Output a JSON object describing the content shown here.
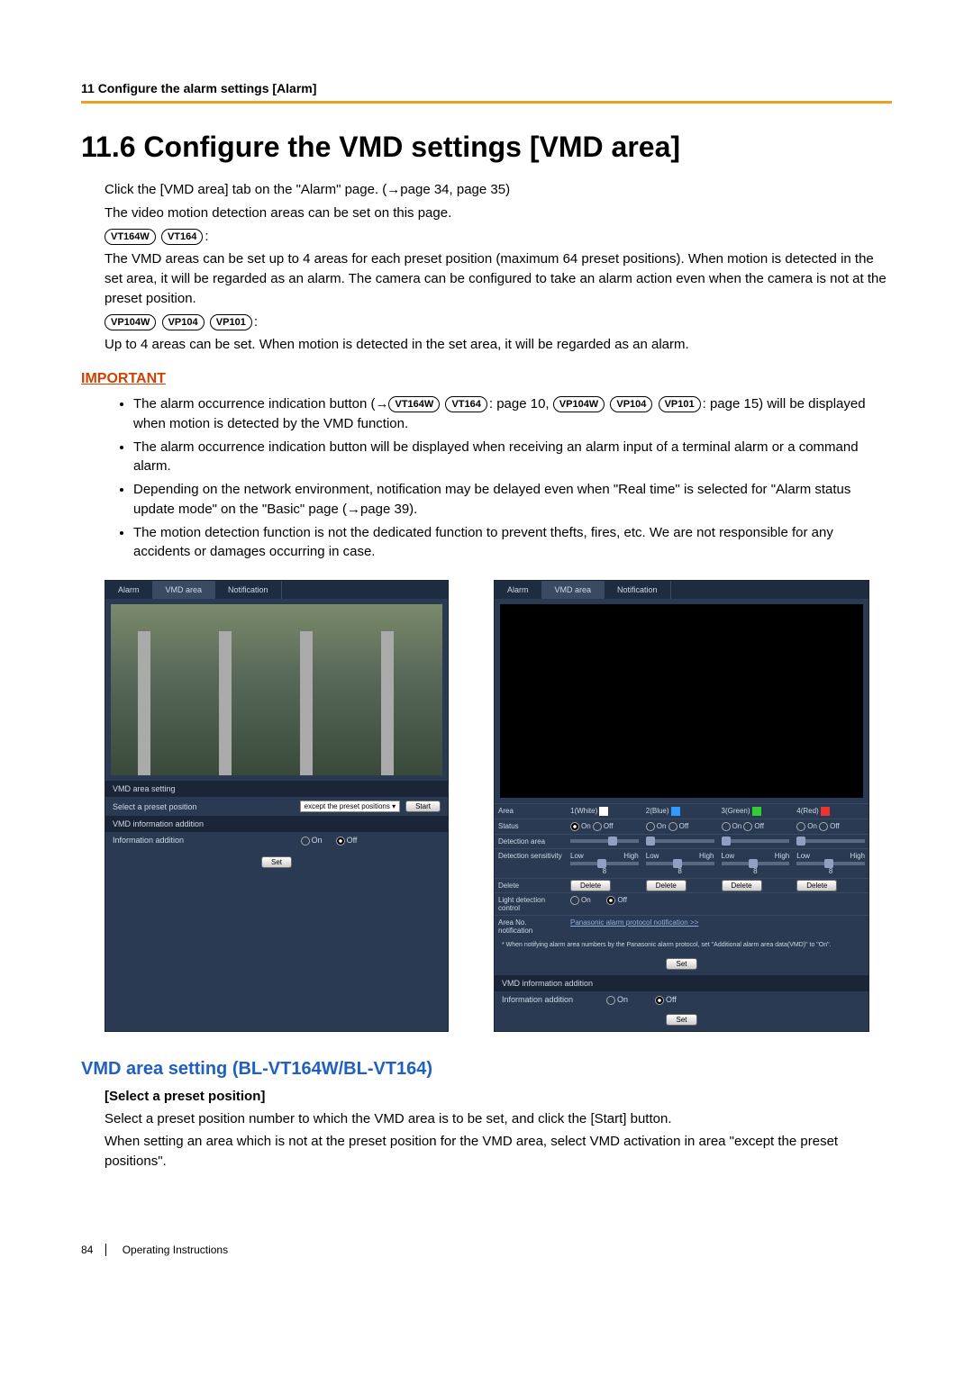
{
  "header": "11 Configure the alarm settings [Alarm]",
  "h1": "11.6  Configure the VMD settings [VMD area]",
  "intro": {
    "p1a": "Click the [VMD area] tab on the \"Alarm\" page. (",
    "p1b": "page 34, page 35)",
    "p2": "The video motion detection areas can be set on this page.",
    "pills1": [
      "VT164W",
      "VT164"
    ],
    "p3": "The VMD areas can be set up to 4 areas for each preset position (maximum 64 preset positions). When motion is detected in the set area, it will be regarded as an alarm. The camera can be configured to take an alarm action even when the camera is not at the preset position.",
    "pills2": [
      "VP104W",
      "VP104",
      "VP101"
    ],
    "p4": "Up to 4 areas can be set. When motion is detected in the set area, it will be regarded as an alarm."
  },
  "important_label": "IMPORTANT",
  "notes": {
    "n1a": "The alarm occurrence indication button (",
    "n1_pills_a": [
      "VT164W",
      "VT164"
    ],
    "n1_mid": ": page 10, ",
    "n1_pills_b": [
      "VP104W",
      "VP104",
      "VP101"
    ],
    "n1b": ": page 15) will be displayed when motion is detected by the VMD function.",
    "n2": "The alarm occurrence indication button will be displayed when receiving an alarm input of a terminal alarm or a command alarm.",
    "n3": "Depending on the network environment, notification may be delayed even when \"Real time\" is selected for \"Alarm status update mode\" on the \"Basic\" page (→page 39).",
    "n4": "The motion detection function is not the dedicated function to prevent thefts, fires, etc. We are not responsible for any accidents or damages occurring in case."
  },
  "shot": {
    "tabs": [
      "Alarm",
      "VMD area",
      "Notification"
    ],
    "sec_vmd": "VMD area setting",
    "select_preset": "Select a preset position",
    "preset_value": "except the preset positions",
    "start": "Start",
    "sec_info": "VMD information addition",
    "info_addition": "Information addition",
    "on": "On",
    "off": "Off",
    "set": "Set",
    "area_hdr": "Area",
    "areas": [
      "1(White)",
      "2(Blue)",
      "3(Green)",
      "4(Red)"
    ],
    "status": "Status",
    "det_area": "Detection area",
    "det_sens": "Detection sensitivity",
    "low": "Low",
    "high": "High",
    "sens_val": "8",
    "delete": "Delete",
    "light": "Light detection control",
    "area_no": "Area No. notification",
    "pan_link": "Panasonic alarm protocol notification >>",
    "footnote": "* When notifying alarm area numbers by the Panasonic alarm protocol, set \"Additional alarm area data(VMD)\" to \"On\"."
  },
  "h2": "VMD area setting (BL-VT164W/BL-VT164)",
  "h3": "[Select a preset position]",
  "p_after_1": "Select a preset position number to which the VMD area is to be set, and click the [Start] button.",
  "p_after_2": "When setting an area which is not at the preset position for the VMD area, select VMD activation in area \"except the preset positions\".",
  "page_number": "84",
  "footer_text": "Operating Instructions"
}
